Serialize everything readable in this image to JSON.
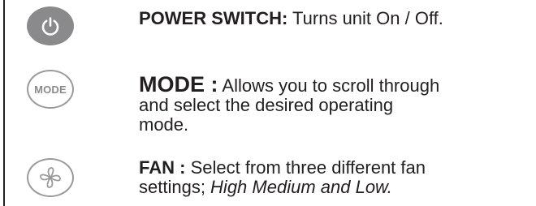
{
  "items": [
    {
      "icon": "power-icon",
      "title": "POWER SWITCH:",
      "description": " Turns unit On / Off."
    },
    {
      "icon": "mode-button-icon",
      "icon_label": "MODE",
      "title": "MODE :",
      "description_lines": [
        " Allows you to scroll through",
        "and select the desired operating",
        "mode."
      ]
    },
    {
      "icon": "fan-icon",
      "title": "FAN :",
      "description_line1": " Select from three different fan",
      "description_line2_prefix": "settings; ",
      "description_line2_italic": "High  Medium and Low."
    }
  ],
  "colors": {
    "text": "#231f20",
    "icon_gray": "#8a8a8d"
  }
}
